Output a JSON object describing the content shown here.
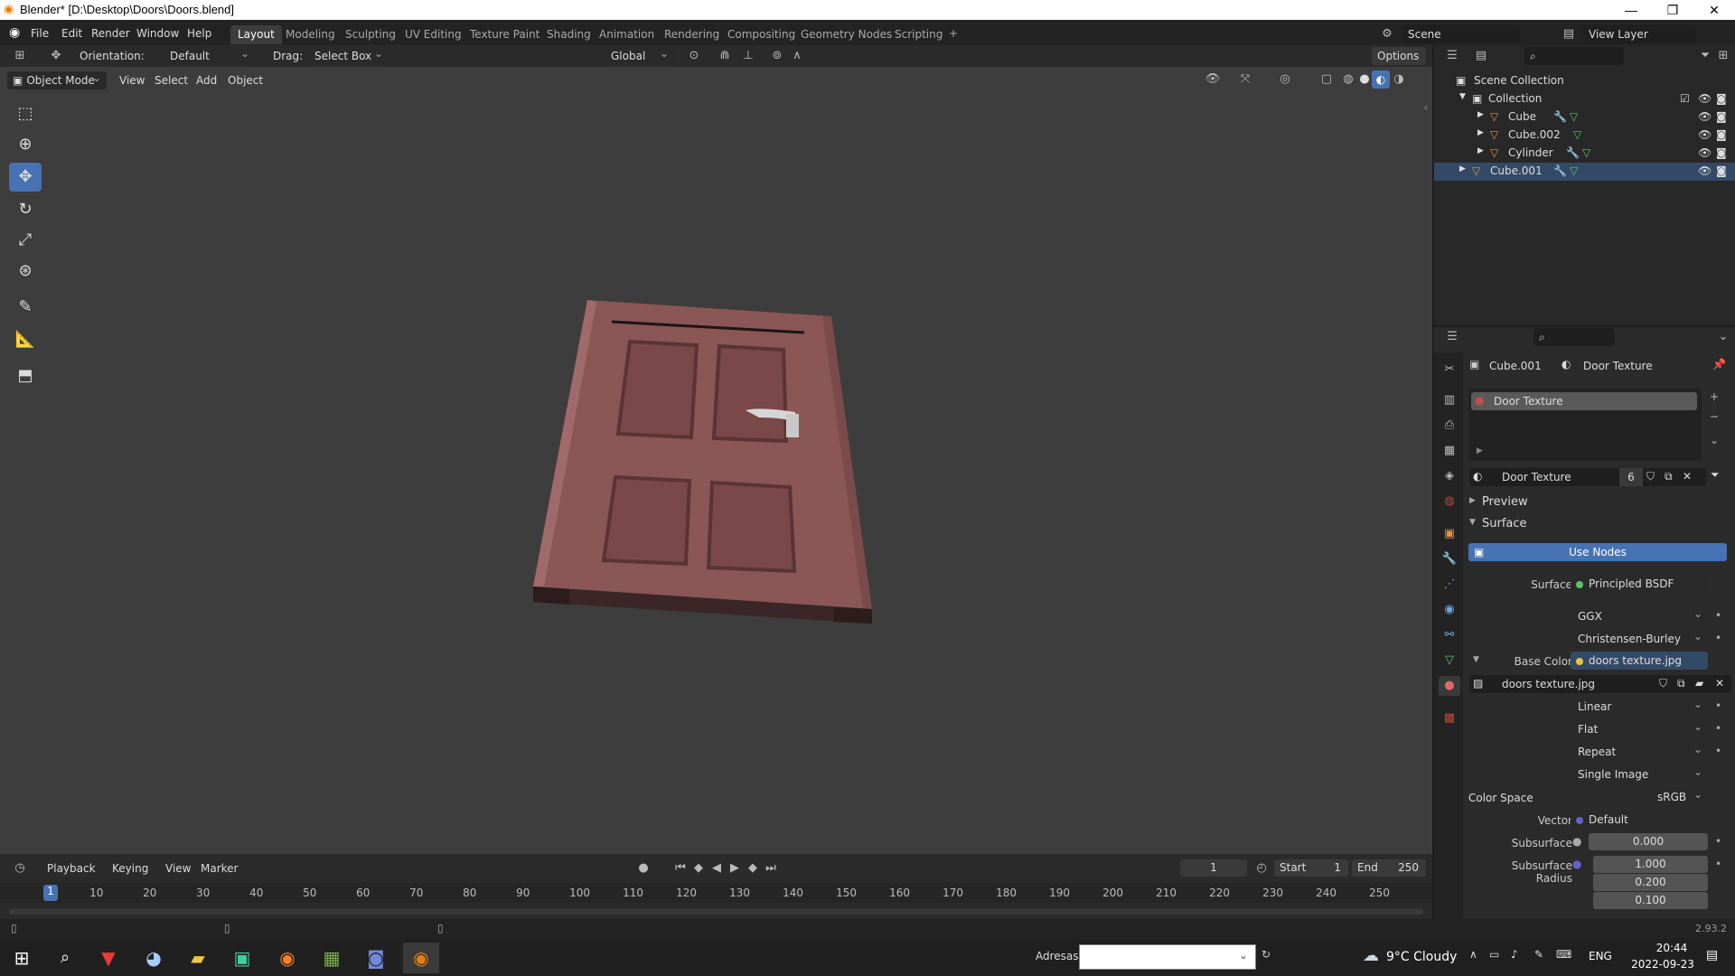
{
  "window": {
    "title": "Blender* [D:\\Desktop\\Doors\\Doors.blend]",
    "min": "—",
    "max": "❐",
    "close": "✕"
  },
  "menu": [
    "File",
    "Edit",
    "Render",
    "Window",
    "Help"
  ],
  "workspaces": [
    "Layout",
    "Modeling",
    "Sculpting",
    "UV Editing",
    "Texture Paint",
    "Shading",
    "Animation",
    "Rendering",
    "Compositing",
    "Geometry Nodes",
    "Scripting"
  ],
  "active_workspace": "Layout",
  "top": {
    "scene_label": "Scene",
    "view_layer_label": "View Layer"
  },
  "toolheader": {
    "orientation_label": "Orientation:",
    "orientation_value": "Default",
    "drag_label": "Drag:",
    "drag_value": "Select Box",
    "transform_value": "Global",
    "options": "Options"
  },
  "viewport_header": {
    "mode": "Object Mode",
    "items": [
      "View",
      "Select",
      "Add",
      "Object"
    ]
  },
  "outliner": {
    "root": "Scene Collection",
    "collection": "Collection",
    "objects": [
      "Cube",
      "Cube.002",
      "Cylinder"
    ],
    "outside": "Cube.001"
  },
  "properties": {
    "object": "Cube.001",
    "material": "Door Texture",
    "slot_name": "Door Texture",
    "mat_name": "Door Texture",
    "users": "6",
    "preview": "Preview",
    "surface_section": "Surface",
    "use_nodes": "Use Nodes",
    "surface_label": "Surface",
    "surface_value": "Principled BSDF",
    "distribution": "GGX",
    "subsurface_method": "Christensen-Burley",
    "base_color_label": "Base Color",
    "base_color_value": "doors texture.jpg",
    "image_name": "doors texture.jpg",
    "interpolation": "Linear",
    "projection": "Flat",
    "extension": "Repeat",
    "source": "Single Image",
    "color_space_label": "Color Space",
    "color_space_value": "sRGB",
    "vector_label": "Vector",
    "vector_value": "Default",
    "subsurface_label": "Subsurface",
    "subsurface_value": "0.000",
    "ss_radius_label": "Subsurface Radius",
    "ss_radius": [
      "1.000",
      "0.200",
      "0.100"
    ]
  },
  "timeline": {
    "menu": [
      "Playback",
      "Keying",
      "View",
      "Marker"
    ],
    "current_frame": "1",
    "start_label": "Start",
    "start_value": "1",
    "end_label": "End",
    "end_value": "250",
    "ticks": [
      "1",
      "10",
      "20",
      "30",
      "40",
      "50",
      "60",
      "70",
      "80",
      "90",
      "100",
      "110",
      "120",
      "130",
      "140",
      "150",
      "160",
      "170",
      "180",
      "190",
      "200",
      "210",
      "220",
      "230",
      "240",
      "250"
    ]
  },
  "status": {
    "version": "2.93.2"
  },
  "taskbar": {
    "address_label": "Adresas",
    "weather": "9°C  Cloudy",
    "lang": "ENG",
    "time": "20:44",
    "date": "2022-09-23"
  },
  "colors": {
    "accent": "#4772b3",
    "door": "#8a5656",
    "viewport": "#3d3d3d"
  }
}
